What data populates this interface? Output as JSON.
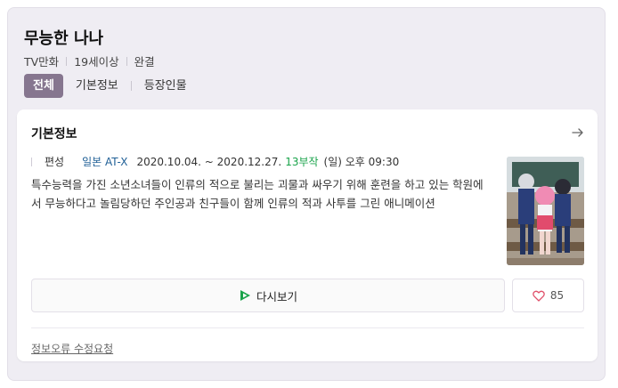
{
  "header": {
    "title": "무능한 나나",
    "meta": [
      "TV만화",
      "19세이상",
      "완결"
    ],
    "tabs": [
      {
        "label": "전체",
        "active": true
      },
      {
        "label": "기본정보",
        "active": false
      },
      {
        "label": "등장인물",
        "active": false
      }
    ]
  },
  "card": {
    "title": "기본정보",
    "arrow_icon": "arrow-right-icon",
    "info": {
      "label": "편성",
      "broadcaster": "일본 AT-X",
      "period": "2020.10.04. ~ 2020.12.27.",
      "episodes": "13부작",
      "schedule": "(일) 오후 09:30"
    },
    "description": "특수능력을 가진 소년소녀들이 인류의 적으로 불리는 괴물과 싸우기 위해 훈련을 하고 있는 학원에서 무능하다고 놀림당하던 주인공과 친구들이 함께 인류의 적과 사투를 그린 애니메이션",
    "watch_button": "다시보기",
    "like_count": "85",
    "report_link": "정보오류 수정요청"
  },
  "colors": {
    "tab_active_bg": "#86768f",
    "link_blue": "#1f5f96",
    "episode_green": "#19a34a",
    "heart": "#e0506a"
  }
}
